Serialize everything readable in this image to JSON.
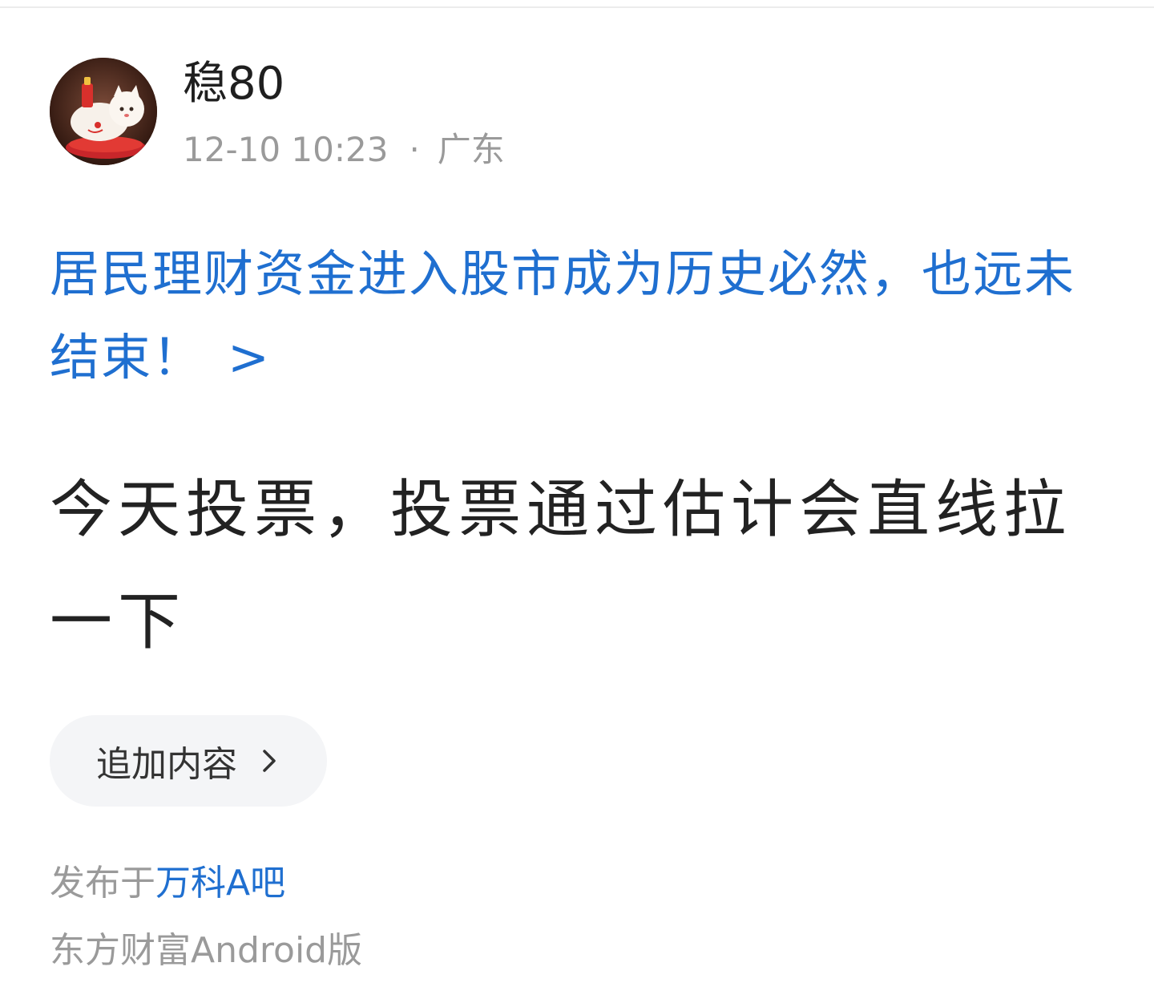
{
  "post": {
    "author": {
      "name": "稳80",
      "avatar_icon": "lucky-cat-avatar"
    },
    "time": "12-10 10:23",
    "separator": "·",
    "location": "广东",
    "headline": {
      "text": "居民理财资金进入股市成为历史必然，也远未结束！",
      "arrow": ">"
    },
    "content": "今天投票，投票通过估计会直线拉一下",
    "add_content_button": {
      "label": "追加内容",
      "icon": "chevron-right-icon"
    },
    "posted_in": {
      "prefix": "发布于",
      "forum": "万科A吧"
    },
    "client": "东方财富Android版"
  },
  "colors": {
    "link": "#1f6fd0",
    "text": "#222222",
    "muted": "#9a9a9a",
    "button_bg": "#f4f5f7"
  }
}
